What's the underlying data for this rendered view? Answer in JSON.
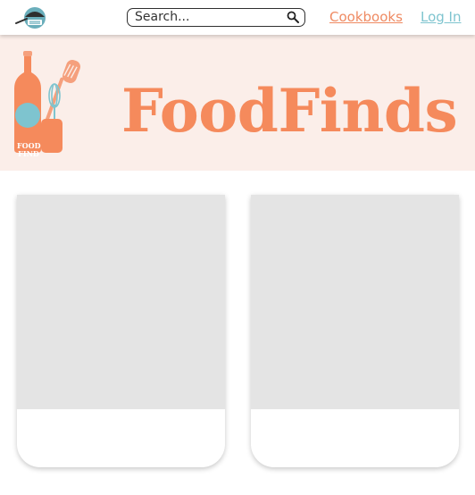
{
  "nav": {
    "logo_icon": "foodfinds-logo-icon",
    "search": {
      "placeholder": "Search...",
      "value": "",
      "icon": "search-icon"
    },
    "links": [
      {
        "label": "Cookbooks",
        "color": "#ef8a62"
      },
      {
        "label": "Log In",
        "color": "#7ec4cf"
      }
    ]
  },
  "hero": {
    "title": "FoodFinds",
    "background": "#fbeee9",
    "title_color": "#f58a5c",
    "badge_text": [
      "FOOD",
      "FIND"
    ],
    "illustration_icon": "bottle-utensils-illustration"
  },
  "cards": [
    {
      "image_placeholder_color": "#e4e4e4"
    },
    {
      "image_placeholder_color": "#e4e4e4"
    }
  ],
  "colors": {
    "accent": "#f58a5c",
    "teal": "#7ec4cf"
  }
}
